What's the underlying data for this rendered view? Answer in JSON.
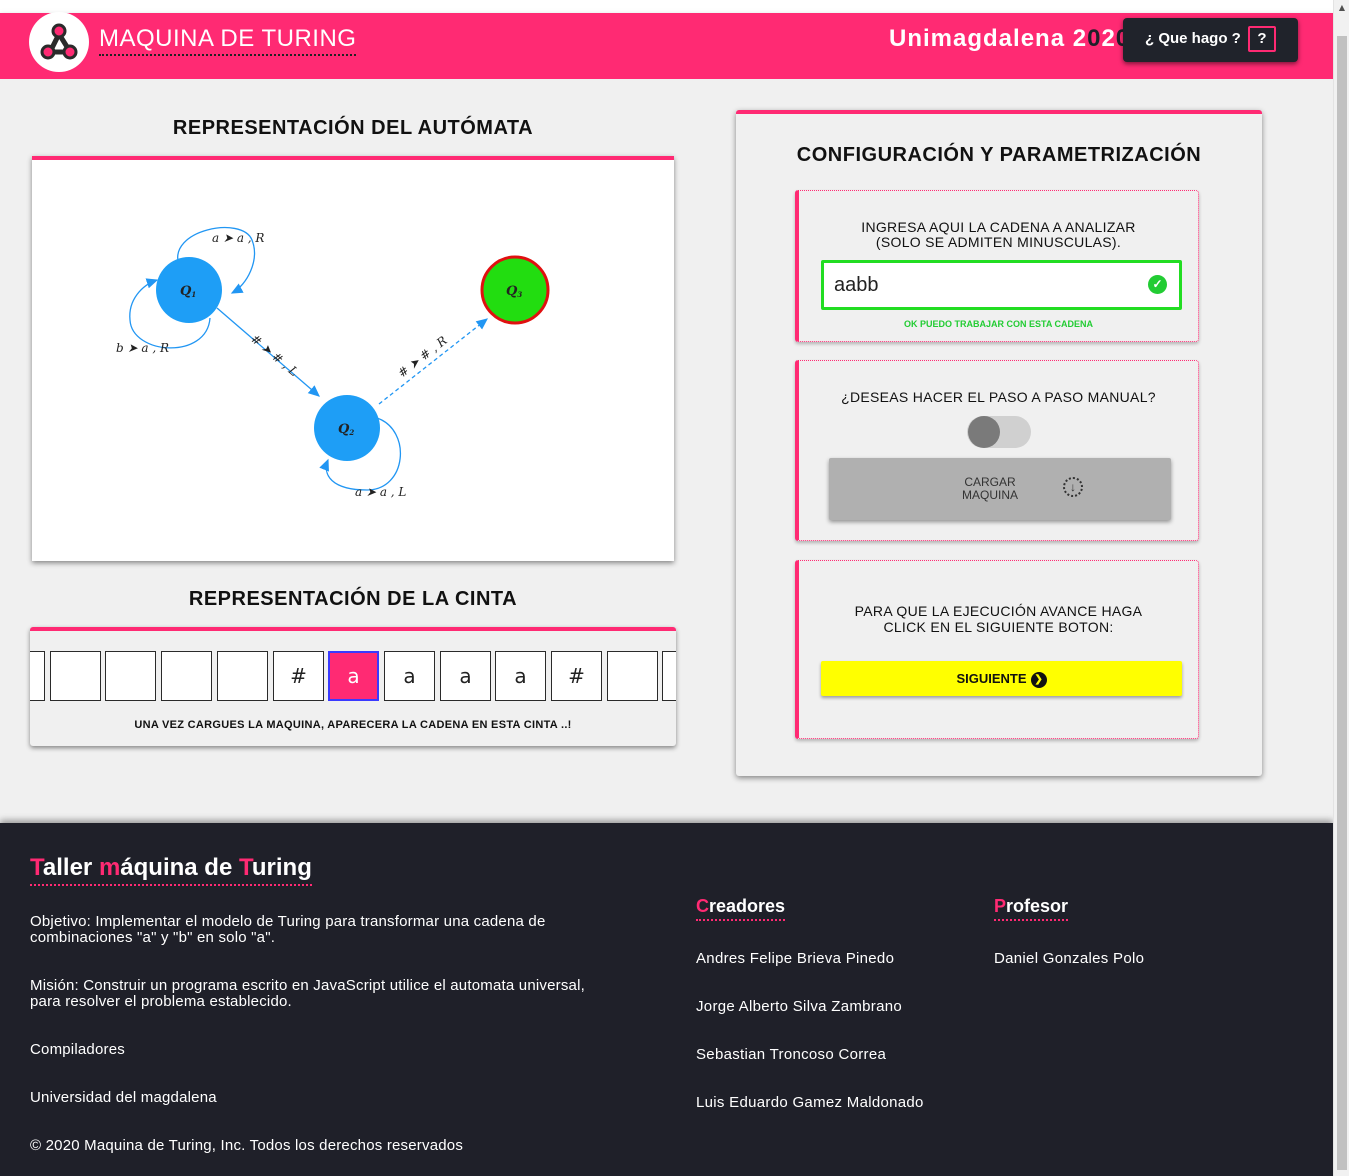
{
  "header": {
    "title_first_letter": "M",
    "title_mid": "AQUINA DE ",
    "title_t": "T",
    "title_end": "URING",
    "brand_u": "U",
    "brand_mid": "nimagdalena 2",
    "brand_zero": "0",
    "brand_2": "2",
    "brand_end": "0",
    "help_label": "¿ Que hago ?",
    "help_icon": "?"
  },
  "automaton": {
    "title": "REPRESENTACIÓN DEL AUTÓMATA",
    "states": [
      {
        "name": "Q",
        "sub": "1",
        "color": "#1e9ef6"
      },
      {
        "name": "Q",
        "sub": "2",
        "color": "#1e9ef6"
      },
      {
        "name": "Q",
        "sub": "3",
        "color": "#22dd10",
        "accepting": true
      }
    ],
    "transitions": [
      {
        "from": "Q1",
        "to": "Q1",
        "read": "a",
        "write": "a",
        "move": "R"
      },
      {
        "from": "Q1",
        "to": "Q1",
        "read": "b",
        "write": "a",
        "move": "R"
      },
      {
        "from": "Q1",
        "to": "Q2",
        "read": "#",
        "write": "#",
        "move": "L"
      },
      {
        "from": "Q2",
        "to": "Q2",
        "read": "a",
        "write": "a",
        "move": "L"
      },
      {
        "from": "Q2",
        "to": "Q3",
        "read": "#",
        "write": "#",
        "move": "R"
      }
    ]
  },
  "tape": {
    "title": "REPRESENTACIÓN DE LA CINTA",
    "cells": [
      "",
      "",
      "",
      "",
      "",
      "#",
      "a",
      "a",
      "a",
      "a",
      "#",
      "",
      ""
    ],
    "active_index": 6,
    "note": "UNA VEZ CARGUES LA MAQUINA, APARECERA LA CADENA EN ESTA CINTA ..!"
  },
  "config": {
    "title": "CONFIGURACIÓN Y PARAMETRIZACIÓN",
    "input_label_1": "INGRESA AQUI LA CADENA A ANALIZAR",
    "input_label_2": "(SOLO SE ADMITEN MINUSCULAS).",
    "input_value": "aabb",
    "input_ok_icon": "check-circle-icon",
    "input_ok_msg": "OK PUEDO TRABAJAR CON ESTA CADENA",
    "manual_question": "¿DESEAS HACER EL PASO A PASO MANUAL?",
    "manual_toggle_on": false,
    "load_label_1": "CARGAR",
    "load_label_2": "MAQUINA",
    "exec_label_1": "PARA QUE LA EJECUCIÓN AVANCE HAGA",
    "exec_label_2": "CLICK EN EL SIGUIENTE BOTON:",
    "next_label": "SIGUIENTE"
  },
  "footer": {
    "title_t": "T",
    "title_aller": "aller ",
    "title_m": "m",
    "title_aquina": "áquina de ",
    "title_t2": "T",
    "title_uring": "uring",
    "objective_1": "Objetivo: Implementar el modelo de Turing para transformar una cadena de",
    "objective_2": "combinaciones \"a\" y \"b\" en solo \"a\".",
    "mission_1": "Misión: Construir un programa escrito en JavaScript utilice el automata universal,",
    "mission_2": "para resolver el problema establecido.",
    "course": "Compiladores",
    "university": "Universidad del magdalena",
    "copyright": "© 2020 Maquina de Turing, Inc. Todos los derechos reservados",
    "creators_title_c": "C",
    "creators_title_rest": "readores",
    "creators": [
      "Andres Felipe Brieva Pinedo",
      "Jorge Alberto Silva Zambrano",
      "Sebastian Troncoso Correa",
      "Luis Eduardo Gamez Maldonado"
    ],
    "professor_title_p": "P",
    "professor_title_rest": "rofesor",
    "professor": "Daniel Gonzales Polo"
  },
  "colors": {
    "accent": "#ff2a73",
    "dark": "#1f2029",
    "state_blue": "#1e9ef6",
    "state_accept": "#22dd10",
    "ok_green": "#22cc33",
    "next_yellow": "#ffff00"
  }
}
